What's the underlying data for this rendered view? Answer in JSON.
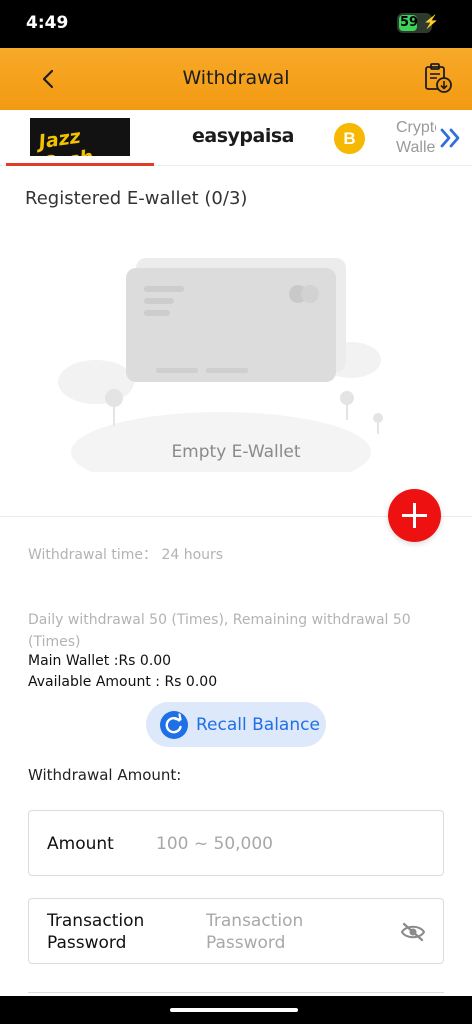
{
  "status_bar": {
    "time": "4:49",
    "battery": "59",
    "battery_level": 0.59
  },
  "header": {
    "title": "Withdrawal",
    "back_icon": "chevron-left-icon",
    "history_icon": "clipboard-download-icon",
    "bg_color": "#f39a12"
  },
  "tabs": [
    {
      "label": "Jazz Cash",
      "selected": true
    },
    {
      "label": "easypaisa",
      "selected": false
    },
    {
      "label": "B",
      "selected": false
    },
    {
      "label": "Crypto Wallet",
      "selected": false
    }
  ],
  "tabs_more_icon": "double-chevron-right-icon",
  "wallet": {
    "section_title": "Registered E-wallet (0/3)",
    "empty_text": "Empty E-Wallet",
    "add_icon": "plus-icon"
  },
  "info": {
    "withdrawal_time": "Withdrawal time： 24 hours",
    "daily_limit": "Daily withdrawal 50 (Times), Remaining withdrawal 50 (Times)",
    "main_wallet": "Main Wallet :Rs 0.00",
    "available_amount": "Available Amount : Rs 0.00"
  },
  "recall": {
    "label": "Recall Balance",
    "icon": "refresh-icon"
  },
  "form": {
    "withdrawal_amount_label": "Withdrawal Amount:",
    "amount_label": "Amount",
    "amount_placeholder": "100 ~ 50,000",
    "password_label": "Transaction Password",
    "password_placeholder": "Transaction Password",
    "password_toggle_icon": "eye-off-icon"
  },
  "colors": {
    "accent": "#f39a12",
    "primary_blue": "#1f6fe5",
    "danger_red": "#ee1111",
    "tab_underline": "#e23a2b"
  }
}
